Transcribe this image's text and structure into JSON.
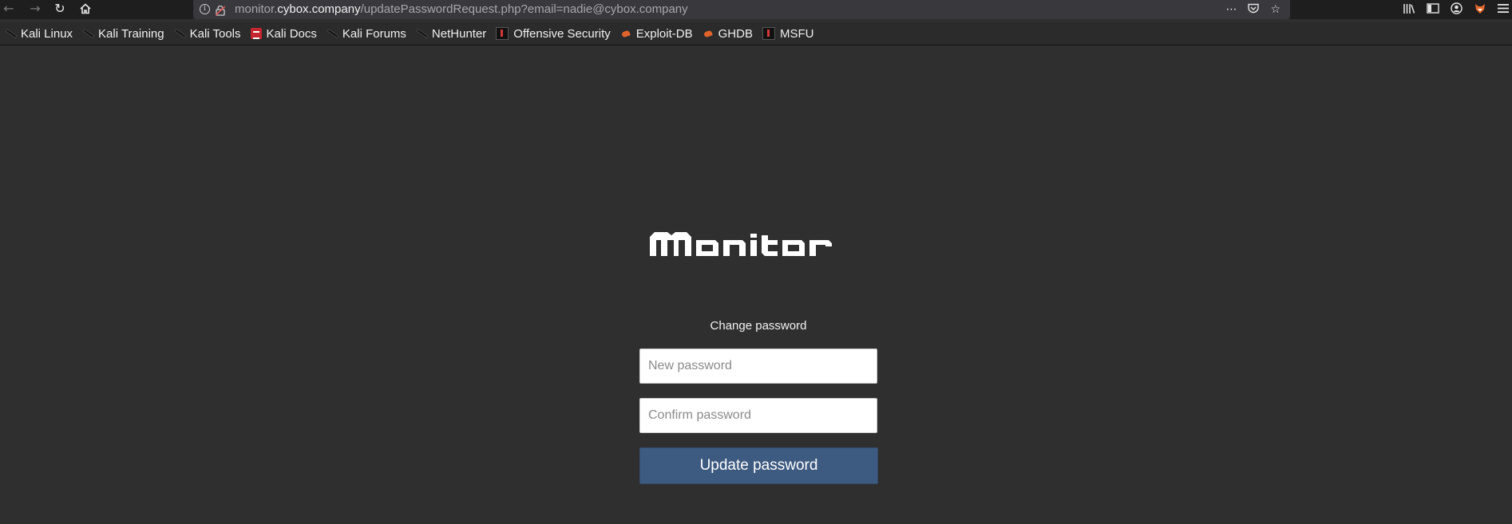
{
  "browser": {
    "url_host": "monitor.",
    "url_domain": "cybox.company",
    "url_path": "/updatePasswordRequest.php?email=nadie@cybox.company"
  },
  "bookmarks": [
    {
      "label": "Kali Linux",
      "icon": "kali-dragon-icon"
    },
    {
      "label": "Kali Training",
      "icon": "kali-dragon-icon"
    },
    {
      "label": "Kali Tools",
      "icon": "kali-dragon-icon"
    },
    {
      "label": "Kali Docs",
      "icon": "kali-docs-icon"
    },
    {
      "label": "Kali Forums",
      "icon": "kali-dragon-icon"
    },
    {
      "label": "NetHunter",
      "icon": "kali-dragon-icon"
    },
    {
      "label": "Offensive Security",
      "icon": "offsec-icon"
    },
    {
      "label": "Exploit-DB",
      "icon": "exploit-db-icon"
    },
    {
      "label": "GHDB",
      "icon": "exploit-db-icon"
    },
    {
      "label": "MSFU",
      "icon": "offsec-icon"
    }
  ],
  "page": {
    "logo_text": "Monitor",
    "subtitle": "Change password",
    "new_password_placeholder": "New password",
    "confirm_password_placeholder": "Confirm password",
    "submit_label": "Update password"
  },
  "colors": {
    "page_background": "#2f2f2f",
    "button": "#3d5a80"
  }
}
